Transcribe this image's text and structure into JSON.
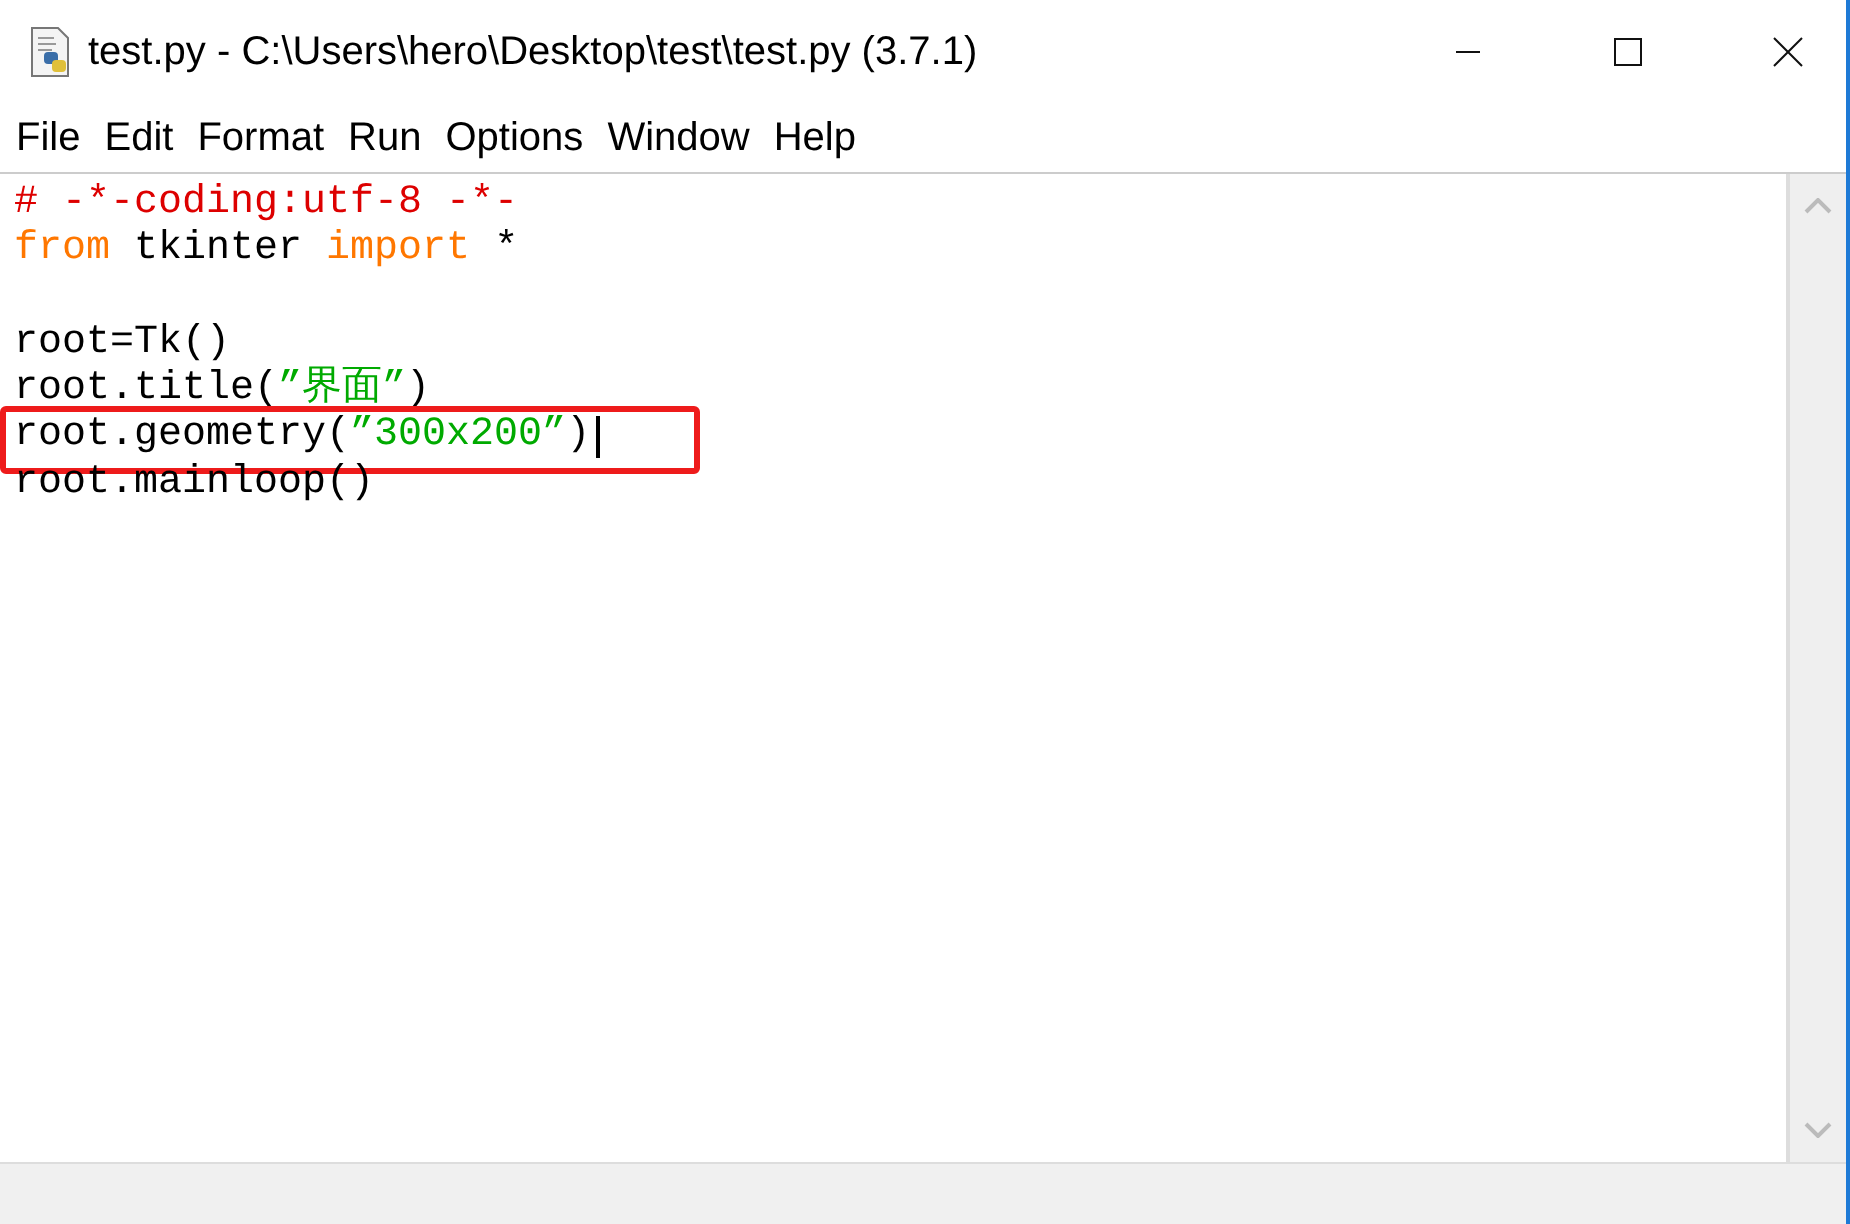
{
  "window": {
    "title": "test.py - C:\\Users\\hero\\Desktop\\test\\test.py (3.7.1)"
  },
  "menu": [
    "File",
    "Edit",
    "Format",
    "Run",
    "Options",
    "Window",
    "Help"
  ],
  "editor": {
    "lines": [
      {
        "tokens": [
          {
            "text": "# -*-coding:utf-8 -*-",
            "kind": "comment"
          }
        ],
        "highlighted": false,
        "cursor": false
      },
      {
        "tokens": [
          {
            "text": "from",
            "kind": "keyword"
          },
          {
            "text": " tkinter ",
            "kind": "plain"
          },
          {
            "text": "import",
            "kind": "keyword"
          },
          {
            "text": " *",
            "kind": "plain"
          }
        ],
        "highlighted": false,
        "cursor": false
      },
      {
        "tokens": [
          {
            "text": "root=Tk()",
            "kind": "plain"
          }
        ],
        "highlighted": false,
        "cursor": false,
        "blank_line_before": true
      },
      {
        "tokens": [
          {
            "text": "root.title(",
            "kind": "plain"
          },
          {
            "text": "”界面”",
            "kind": "string"
          },
          {
            "text": ")",
            "kind": "plain"
          }
        ],
        "highlighted": false,
        "cursor": false
      },
      {
        "tokens": [
          {
            "text": "root.geometry(",
            "kind": "plain"
          },
          {
            "text": "”300x200”",
            "kind": "string"
          },
          {
            "text": ")",
            "kind": "plain"
          }
        ],
        "highlighted": true,
        "cursor": true
      },
      {
        "tokens": [
          {
            "text": "root.mainloop()",
            "kind": "plain"
          }
        ],
        "highlighted": false,
        "cursor": false
      }
    ]
  }
}
